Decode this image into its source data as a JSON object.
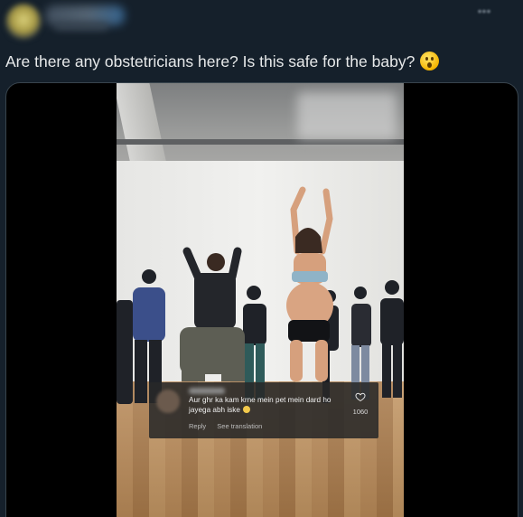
{
  "tweet": {
    "text": "Are there any obstetricians here? Is this safe for the baby?",
    "emoji": "astonished-face"
  },
  "video": {
    "comment": {
      "text": "Aur ghr ka kam krne mein pet mein dard ho jayega abh iske",
      "emoji": "laughing-face",
      "like_count": "1060",
      "reply_label": "Reply",
      "translate_label": "See translation"
    }
  },
  "colors": {
    "background": "#15202b",
    "text": "#e7e9ea",
    "card_border": "#38444d",
    "letterbox": "#000000"
  }
}
